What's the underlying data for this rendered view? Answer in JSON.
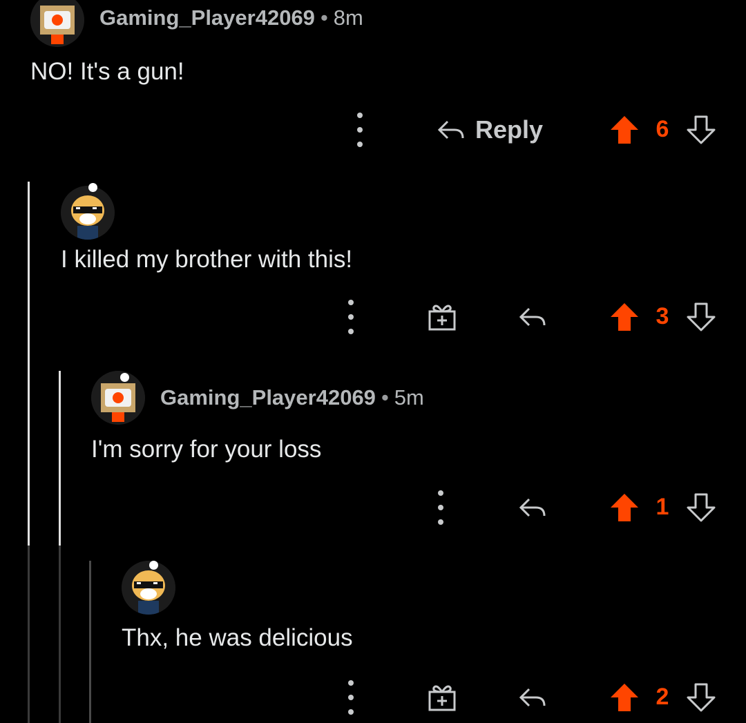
{
  "colors": {
    "background": "#000000",
    "upvote": "#ff4500",
    "thread_line_active": "#e0e0e0",
    "thread_line_inactive": "#4a4a4a"
  },
  "comments": [
    {
      "username": "Gaming_Player42069",
      "separator": "•",
      "time": "8m",
      "body": "NO! It's a gun!",
      "reply_label": "Reply",
      "score": "6",
      "avatar": "robot-box-avatar"
    },
    {
      "username": "",
      "time": "",
      "body": "I killed my brother with this!",
      "score": "3",
      "avatar": "doge-sunglasses-avatar"
    },
    {
      "username": "Gaming_Player42069",
      "separator": "•",
      "time": "5m",
      "body": "I'm sorry for your loss",
      "score": "1",
      "avatar": "robot-box-avatar"
    },
    {
      "username": "",
      "time": "",
      "body": "Thx, he was delicious",
      "score": "2",
      "avatar": "doge-sunglasses-avatar"
    }
  ],
  "icons": [
    "more-options-icon",
    "reply-arrow-icon",
    "upvote-arrow-icon",
    "downvote-arrow-icon",
    "award-gift-icon"
  ]
}
